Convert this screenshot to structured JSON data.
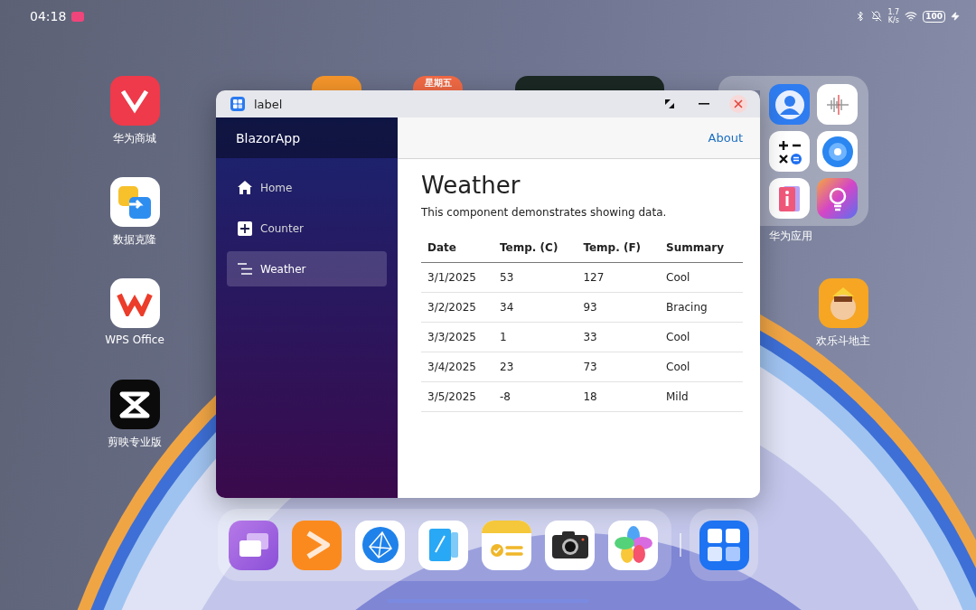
{
  "status_bar": {
    "time": "04:18",
    "speed_value": "1.7",
    "speed_unit": "K/s",
    "battery": "100"
  },
  "desktop_apps": [
    {
      "label": "华为商城",
      "kind": "vmall"
    },
    {
      "label": "数据克隆",
      "kind": "clone"
    },
    {
      "label": "WPS Office",
      "kind": "wps"
    },
    {
      "label": "剪映专业版",
      "kind": "capcut"
    },
    {
      "label": "欢乐斗地主",
      "kind": "game"
    }
  ],
  "calendar": {
    "weekday": "星期五"
  },
  "folder": {
    "label": "华为应用"
  },
  "window": {
    "title": "label",
    "brand": "BlazorApp",
    "top_link": "About",
    "nav": [
      {
        "label": "Home",
        "kind": "home",
        "selected": false
      },
      {
        "label": "Counter",
        "kind": "plus",
        "selected": false
      },
      {
        "label": "Weather",
        "kind": "list",
        "selected": true
      }
    ],
    "page": {
      "heading": "Weather",
      "description": "This component demonstrates showing data.",
      "table": {
        "columns": [
          "Date",
          "Temp. (C)",
          "Temp. (F)",
          "Summary"
        ],
        "rows": [
          [
            "3/1/2025",
            "53",
            "127",
            "Cool"
          ],
          [
            "3/2/2025",
            "34",
            "93",
            "Bracing"
          ],
          [
            "3/3/2025",
            "1",
            "33",
            "Cool"
          ],
          [
            "3/4/2025",
            "23",
            "73",
            "Cool"
          ],
          [
            "3/5/2025",
            "-8",
            "18",
            "Mild"
          ]
        ]
      }
    }
  }
}
